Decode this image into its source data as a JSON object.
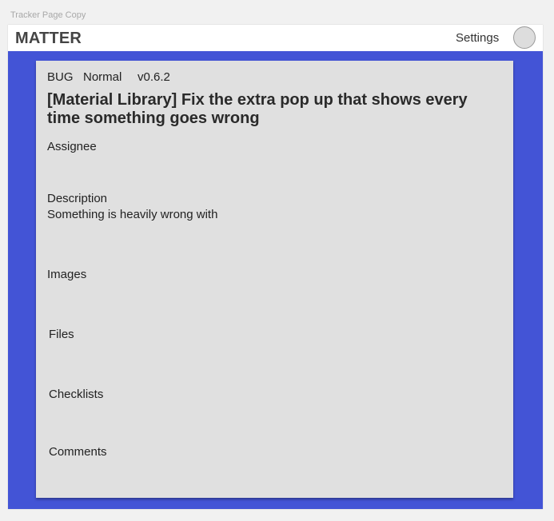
{
  "frame": {
    "label": "Tracker Page Copy"
  },
  "appbar": {
    "brand": "MATTER",
    "settings_label": "Settings"
  },
  "issue": {
    "type": "BUG",
    "priority": "Normal",
    "version": "v0.6.2",
    "title": "[Material Library] Fix the extra pop up that shows every time something goes wrong",
    "sections": {
      "assignee_label": "Assignee",
      "description_label": "Description",
      "description_text": "Something is heavily wrong with",
      "images_label": "Images",
      "files_label": "Files",
      "checklists_label": "Checklists",
      "comments_label": "Comments"
    }
  },
  "colors": {
    "accent": "#4354d6",
    "card_background": "#e0e0e0",
    "page_background": "#f1f1f1"
  }
}
